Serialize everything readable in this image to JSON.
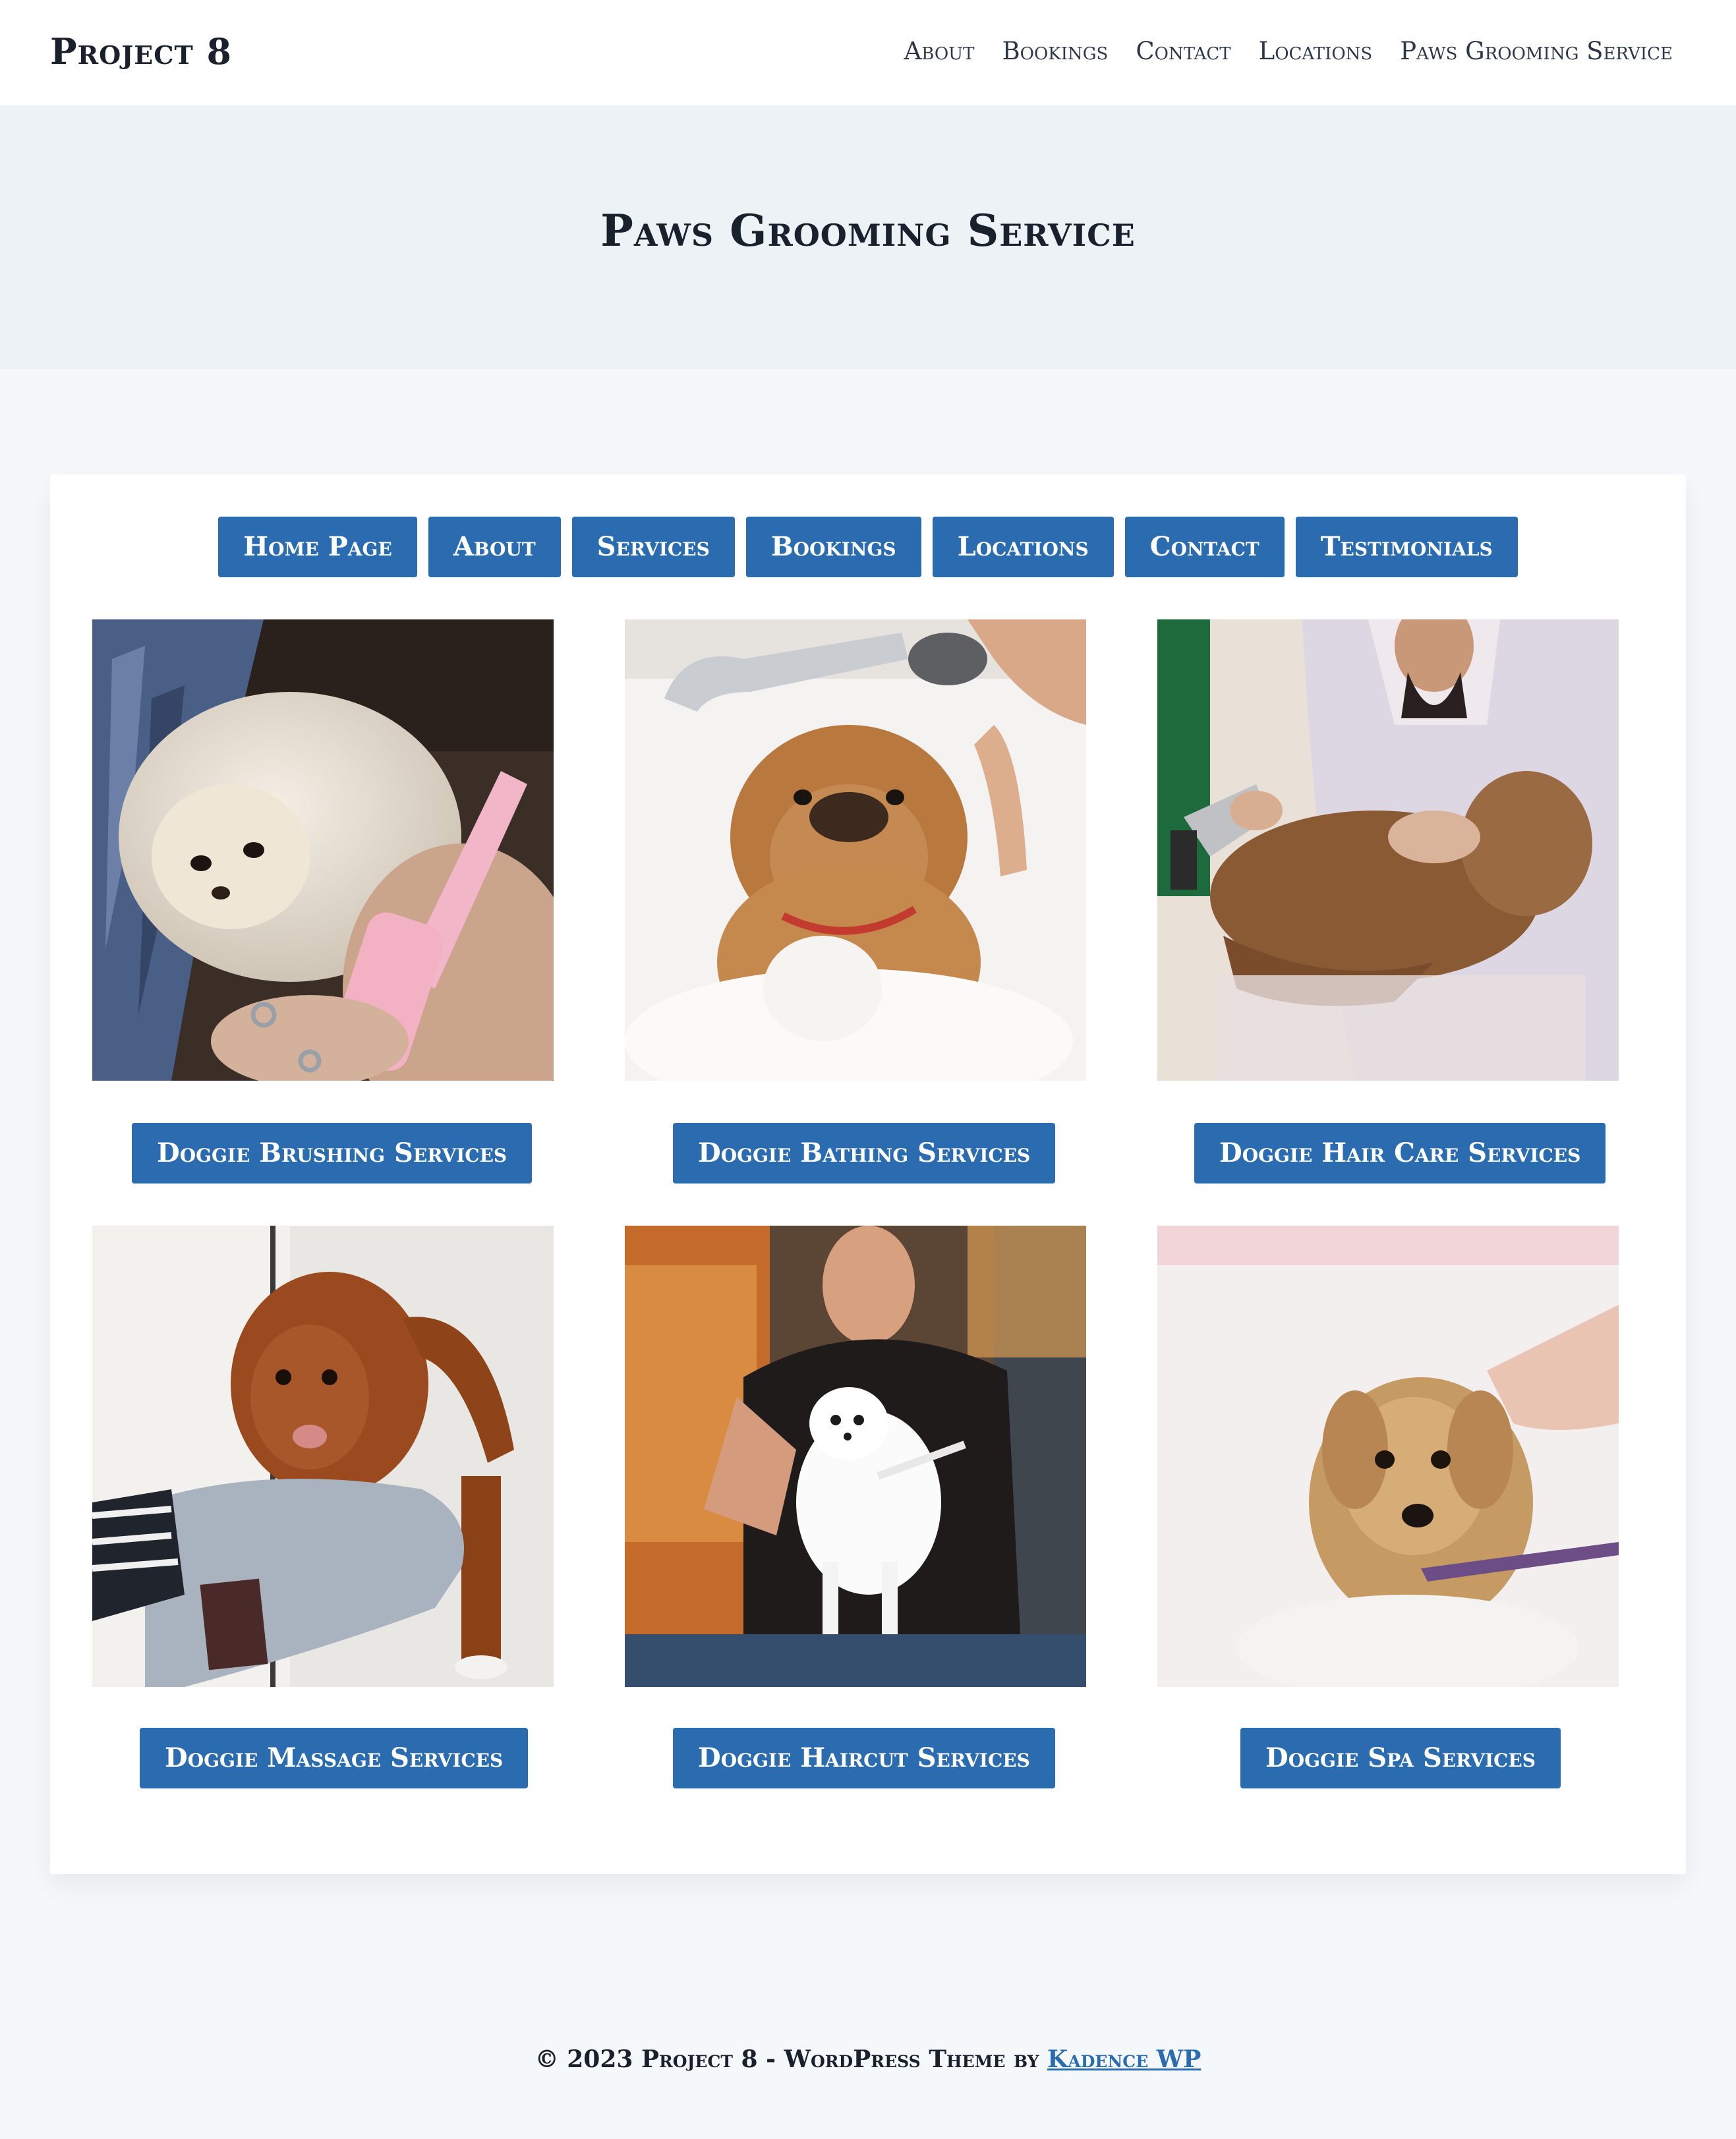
{
  "site": {
    "title": "Project 8"
  },
  "nav": {
    "items": [
      "About",
      "Bookings",
      "Contact",
      "Locations",
      "Paws Grooming Service"
    ]
  },
  "hero": {
    "title": "Paws Grooming Service"
  },
  "page_buttons": [
    "Home Page",
    "About",
    "Services",
    "Bookings",
    "Locations",
    "Contact",
    "Testimonials"
  ],
  "services": [
    {
      "label": "Doggie Brushing Services",
      "image": "dog-brushing-photo"
    },
    {
      "label": "Doggie Bathing Services",
      "image": "dog-bathing-photo"
    },
    {
      "label": "Doggie Hair Care Services",
      "image": "dog-hair-drying-photo"
    },
    {
      "label": "Doggie Massage Services",
      "image": "dog-towel-massage-photo"
    },
    {
      "label": "Doggie Haircut Services",
      "image": "dog-haircut-photo"
    },
    {
      "label": "Doggie Spa Services",
      "image": "dog-spa-photo"
    }
  ],
  "footer": {
    "text": "© 2023 Project 8 - WordPress Theme by ",
    "link": "Kadence WP"
  },
  "colors": {
    "accent": "#2b6cb0",
    "hero_bg": "#edf2f7",
    "page_bg": "#f5f8fb"
  }
}
